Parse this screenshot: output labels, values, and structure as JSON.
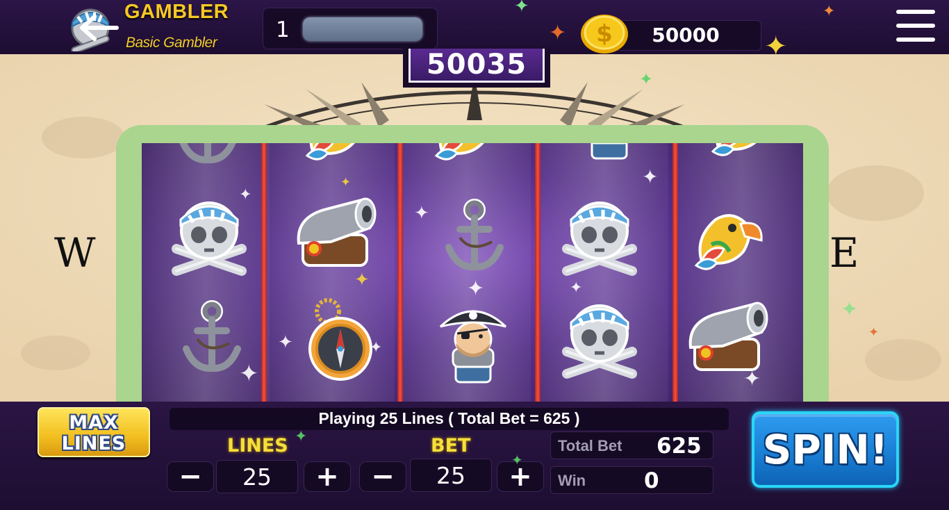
{
  "header": {
    "player_name": "GAMBLER",
    "player_rank": "Basic Gambler",
    "level": "1",
    "coins": "50000",
    "jackpot": "50035"
  },
  "background": {
    "compass_letter_west": "W",
    "compass_letter_east": "E"
  },
  "reels": [
    [
      "anchor",
      "skull-crossbones",
      "anchor"
    ],
    [
      "parrot",
      "cannon",
      "compass"
    ],
    [
      "parrot",
      "anchor",
      "pirate-captain"
    ],
    [
      "pirate-captain",
      "skull-crossbones",
      "skull-crossbones"
    ],
    [
      "parrot",
      "parrot",
      "cannon"
    ]
  ],
  "controls": {
    "max_lines_line1": "MAX",
    "max_lines_line2": "LINES",
    "status_message": "Playing 25 Lines ( Total Bet = 625 )",
    "lines_label": "LINES",
    "lines_value": "25",
    "bet_label": "BET",
    "bet_value": "25",
    "minus_symbol": "−",
    "plus_symbol": "+",
    "total_bet_label": "Total Bet",
    "total_bet_value": "625",
    "win_label": "Win",
    "win_value": "0",
    "spin_label": "SPIN!"
  },
  "colors": {
    "accent_gold": "#f6c823",
    "spin_blue": "#1a7fd5",
    "reel_frame_green": "#a9d58e",
    "reel_divider_red": "#ff4e3a"
  }
}
